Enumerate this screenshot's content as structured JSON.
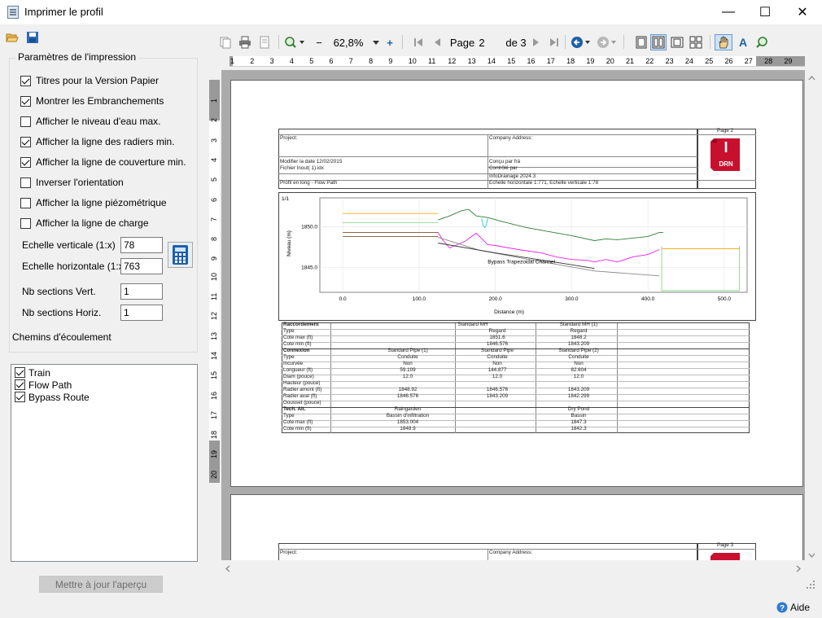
{
  "window": {
    "title": "Imprimer le profil",
    "minimize": "—",
    "maximize": "☐",
    "close": "✕"
  },
  "left": {
    "group_title": "Paramètres de l'impression",
    "options": [
      {
        "label": "Titres pour la Version Papier",
        "checked": true
      },
      {
        "label": "Montrer les Embranchements",
        "checked": true
      },
      {
        "label": "Afficher le niveau d'eau max.",
        "checked": false
      },
      {
        "label": "Afficher la ligne des radiers min.",
        "checked": true
      },
      {
        "label": "Afficher la ligne de couverture min.",
        "checked": true
      },
      {
        "label": "Inverser l'orientation",
        "checked": false
      },
      {
        "label": "Afficher la ligne piézométrique",
        "checked": false
      },
      {
        "label": "Afficher la ligne de charge",
        "checked": false
      }
    ],
    "scale_v_label": "Echelle verticale (1:x)",
    "scale_v": "78",
    "scale_h_label": "Echelle horizontale (1:x)",
    "scale_h": "763",
    "nb_v_label": "Nb sections Vert.",
    "nb_v": "1",
    "nb_h_label": "Nb sections Horiz.",
    "nb_h": "1",
    "paths_label": "Chemins d'écoulement",
    "paths": [
      {
        "label": "Train",
        "checked": true
      },
      {
        "label": "Flow Path",
        "checked": true
      },
      {
        "label": "Bypass Route",
        "checked": true
      }
    ],
    "update_button": "Mettre à jour l'aperçu"
  },
  "toolbar": {
    "zoom": "62,8%",
    "page_label": "Page",
    "page": "2",
    "of_label": "de 3",
    "minus": "−",
    "plus": "+"
  },
  "ruler_h": [
    "1",
    "2",
    "3",
    "4",
    "5",
    "6",
    "7",
    "8",
    "9",
    "10",
    "11",
    "12",
    "13",
    "14",
    "15",
    "16",
    "17",
    "18",
    "19",
    "20",
    "21",
    "22",
    "23",
    "24",
    "25",
    "26",
    "27",
    "28",
    "29"
  ],
  "ruler_v": [
    "1",
    "2",
    "3",
    "4",
    "5",
    "6",
    "7",
    "8",
    "9",
    "10",
    "11",
    "12",
    "13",
    "14",
    "15",
    "16",
    "17",
    "18",
    "19",
    "20"
  ],
  "report": {
    "page_no": "Page 2",
    "project": "Project:",
    "company": "Company Address:",
    "modified": "Modifier la date 12/02/2015",
    "file": "Fichier Inout( 1).idx",
    "designed": "Conçu par frá",
    "checked_by": "Contrôlé par",
    "software": "InfoDrainage 2024.3",
    "profile": "Profil en long - Flow Path",
    "scales": "Echelle horizontale 1:771, Echelle verticale 1:78",
    "logo_letter": "I",
    "logo_text": "DRN",
    "page3_no": "Page 3"
  },
  "chart_data": {
    "type": "line",
    "title": "",
    "corner_label": "1/1",
    "xlabel": "Distance (m)",
    "ylabel": "Niveau (m)",
    "xlim": [
      -30,
      530
    ],
    "ylim": [
      1842,
      1853.5
    ],
    "xticks": [
      0,
      100,
      200,
      300,
      400,
      500
    ],
    "xtick_labels": [
      "0.0",
      "100.0",
      "200.0",
      "300.0",
      "400.0",
      "500.0"
    ],
    "yticks": [
      1845,
      1850
    ],
    "ytick_labels": [
      "1845.0",
      "1850.0"
    ],
    "annotation": "Bypass Trapezoidal Channel",
    "series": [
      {
        "color": "#2e7d32",
        "x": [
          125,
          140,
          155,
          165,
          175,
          190,
          210,
          240,
          270,
          300,
          330,
          345,
          360,
          380,
          400,
          415,
          420
        ],
        "y": [
          1850.8,
          1851.3,
          1851.9,
          1852.1,
          1851.3,
          1851.1,
          1850.6,
          1849.9,
          1849.4,
          1848.9,
          1848.3,
          1848.5,
          1848.4,
          1848.6,
          1848.8,
          1849.3,
          1849.3
        ]
      },
      {
        "color": "#e91ee6",
        "x": [
          125,
          130,
          140,
          150,
          160,
          175,
          190,
          200,
          230,
          260,
          280,
          300,
          320,
          330,
          345,
          360,
          380,
          400,
          415
        ],
        "y": [
          1849.3,
          1848.5,
          1847.4,
          1847.8,
          1848.2,
          1849.2,
          1847.8,
          1847.7,
          1847.2,
          1846.8,
          1846.3,
          1846.0,
          1845.9,
          1845.7,
          1846.0,
          1845.7,
          1846.3,
          1846.6,
          1847.2
        ]
      },
      {
        "color": "#888888",
        "x": [
          125,
          180,
          250,
          330,
          415
        ],
        "y": [
          1848.7,
          1847.1,
          1845.9,
          1844.6,
          1844.0
        ]
      },
      {
        "color": "#333333",
        "x": [
          125,
          200,
          270,
          330
        ],
        "y": [
          1848.0,
          1846.8,
          1845.8,
          1844.9
        ]
      },
      {
        "color": "#f2b01e",
        "x": [
          0,
          125
        ],
        "y": [
          1851.6,
          1851.6
        ]
      },
      {
        "color": "#f2b01e",
        "x": [
          418,
          520
        ],
        "y": [
          1847.3,
          1847.3
        ]
      },
      {
        "color": "#8bd48b",
        "x": [
          0,
          125
        ],
        "y": [
          1850.5,
          1850.5
        ]
      },
      {
        "color": "#7a5230",
        "x": [
          0,
          125
        ],
        "y": [
          1849.3,
          1849.3
        ]
      },
      {
        "color": "#7a5230",
        "x": [
          0,
          125
        ],
        "y": [
          1848.8,
          1848.8
        ]
      },
      {
        "color": "#1ec8e0",
        "x": [
          182,
          184,
          186,
          188,
          190
        ],
        "y": [
          1851.0,
          1850.1,
          1849.9,
          1850.1,
          1851.0
        ]
      },
      {
        "color": "#8bd48b",
        "x": [
          418,
          418,
          520,
          520
        ],
        "y": [
          1847.6,
          1842.2,
          1842.2,
          1847.6
        ]
      }
    ]
  },
  "table": {
    "rows": [
      {
        "h": "Raccordement",
        "c1": "",
        "c2": "Standard MH",
        "c3": "Standard MH (1)",
        "bold": true
      },
      {
        "h": "Type",
        "c1": "",
        "c2": "Regard",
        "c3": "Regard"
      },
      {
        "h": "Cote max (ft)",
        "c1": "",
        "c2": "1851.6",
        "c3": "1848.2"
      },
      {
        "h": "Cote min (ft)",
        "c1": "",
        "c2": "1846.576",
        "c3": "1843.209"
      },
      {
        "h": "Connexion",
        "c1": "Standard Pipe (1)",
        "c2": "Standard Pipe",
        "c3": "Standard Pipe (2)",
        "bold": true
      },
      {
        "h": "Type",
        "c1": "Conduite",
        "c2": "Conduite",
        "c3": "Conduite"
      },
      {
        "h": "Incurvée",
        "c1": "Non",
        "c2": "Non",
        "c3": "Non"
      },
      {
        "h": "Longueur (ft)",
        "c1": "59.109",
        "c2": "144.877",
        "c3": "82.604"
      },
      {
        "h": "Diam (pouce)",
        "c1": "12.0",
        "c2": "12.0",
        "c3": "12.0"
      },
      {
        "h": "Hauteur (pouce)",
        "c1": "",
        "c2": "",
        "c3": ""
      },
      {
        "h": "Radier amont (ft)",
        "c1": "1848.92",
        "c2": "1846.576",
        "c3": "1843.209"
      },
      {
        "h": "Radier aval (ft)",
        "c1": "1846.576",
        "c2": "1843.209",
        "c3": "1842.299"
      },
      {
        "h": "Gousset (pouce)",
        "c1": "",
        "c2": "",
        "c3": ""
      },
      {
        "h": "Tech. Alt.",
        "c1": "Raingarden",
        "c2": "",
        "c3": "Dry Pond",
        "bold": true
      },
      {
        "h": "Type",
        "c1": "Bassin d'infiltration",
        "c2": "",
        "c3": "Bassin"
      },
      {
        "h": "Cote max (ft)",
        "c1": "1853.004",
        "c2": "",
        "c3": "1847.3"
      },
      {
        "h": "Cote min (ft)",
        "c1": "1848.9",
        "c2": "",
        "c3": "1842.3"
      }
    ]
  },
  "status": {
    "help": "Aide"
  }
}
